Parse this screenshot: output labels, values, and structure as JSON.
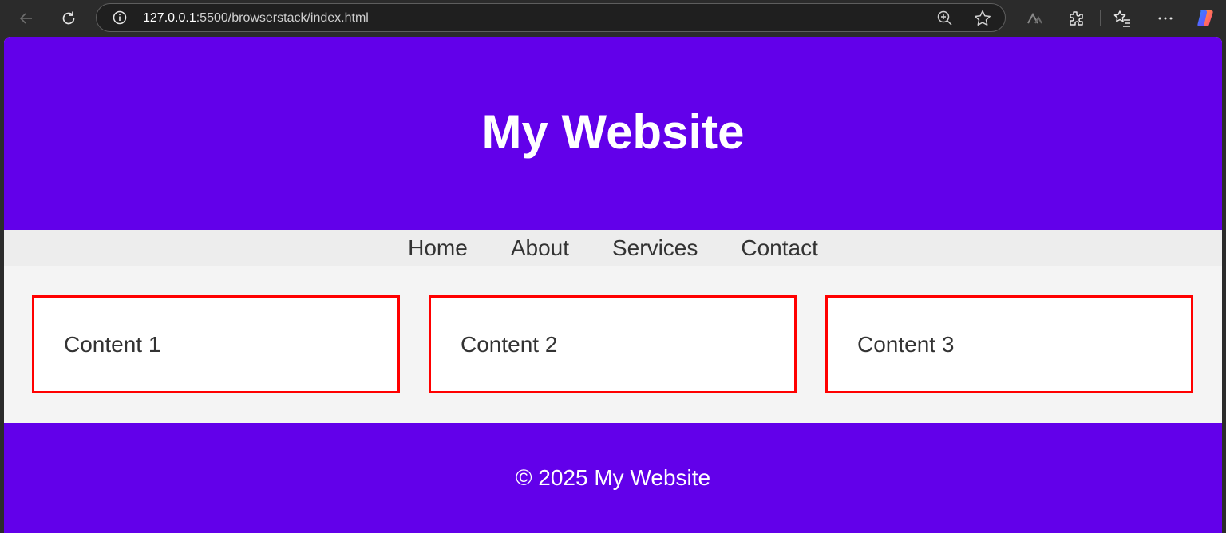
{
  "browser": {
    "url_host": "127.0.0.1",
    "url_rest": ":5500/browserstack/index.html",
    "icons": [
      "back-arrow-icon",
      "reload-icon",
      "site-info-icon",
      "zoom-icon",
      "favorite-star-icon",
      "translate-icon",
      "extensions-icon",
      "favorites-list-icon",
      "more-options-icon",
      "copilot-icon"
    ]
  },
  "page": {
    "header_title": "My Website",
    "nav": [
      "Home",
      "About",
      "Services",
      "Contact"
    ],
    "cards": [
      "Content 1",
      "Content 2",
      "Content 3"
    ],
    "footer_text": "© 2025 My Website"
  },
  "colors": {
    "brand": "#6200ea",
    "nav_bg": "#ededed",
    "card_border": "#ff0000",
    "page_bg": "#f4f4f4"
  }
}
